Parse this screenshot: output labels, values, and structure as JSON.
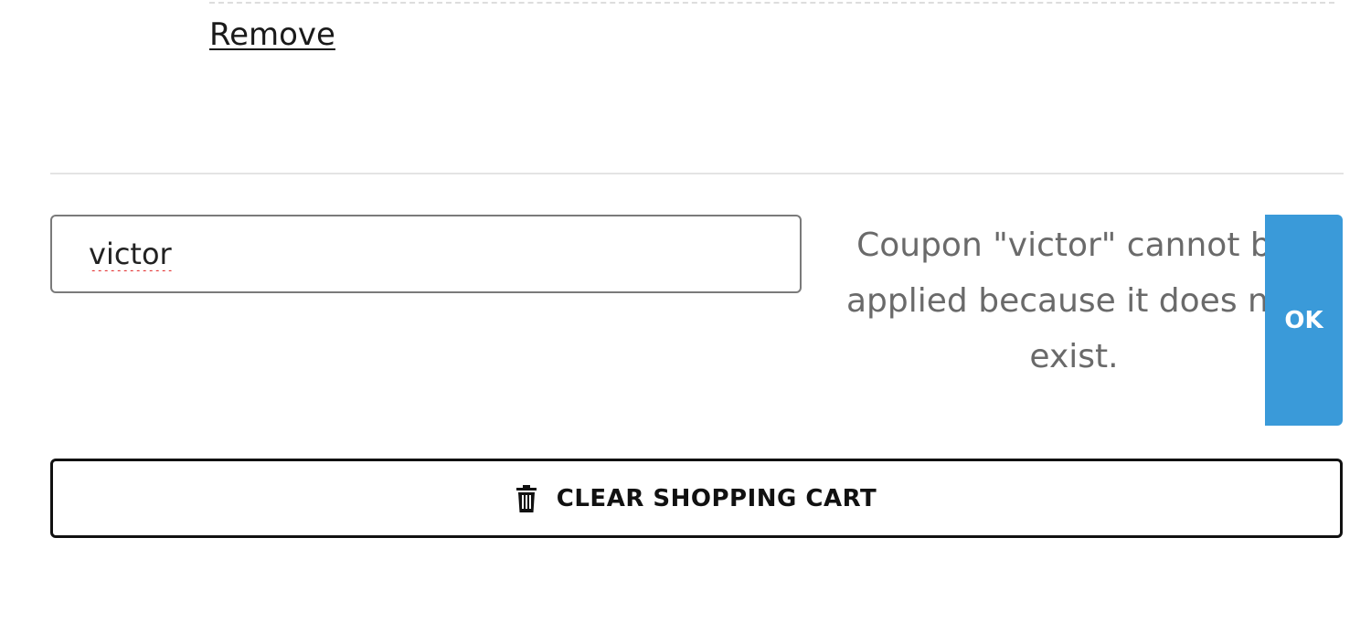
{
  "cart_item": {
    "remove_label": "Remove"
  },
  "coupon": {
    "input_value": "victor",
    "message": "Coupon \"victor\" cannot be applied because it does not exist.",
    "ok_label": "OK"
  },
  "actions": {
    "clear_cart_label": "CLEAR SHOPPING CART",
    "clear_cart_icon": "trash-icon"
  },
  "colors": {
    "ok_button_bg": "#3a9ad9",
    "message_text": "#6a6a6a",
    "spellcheck_underline": "#e02020"
  }
}
